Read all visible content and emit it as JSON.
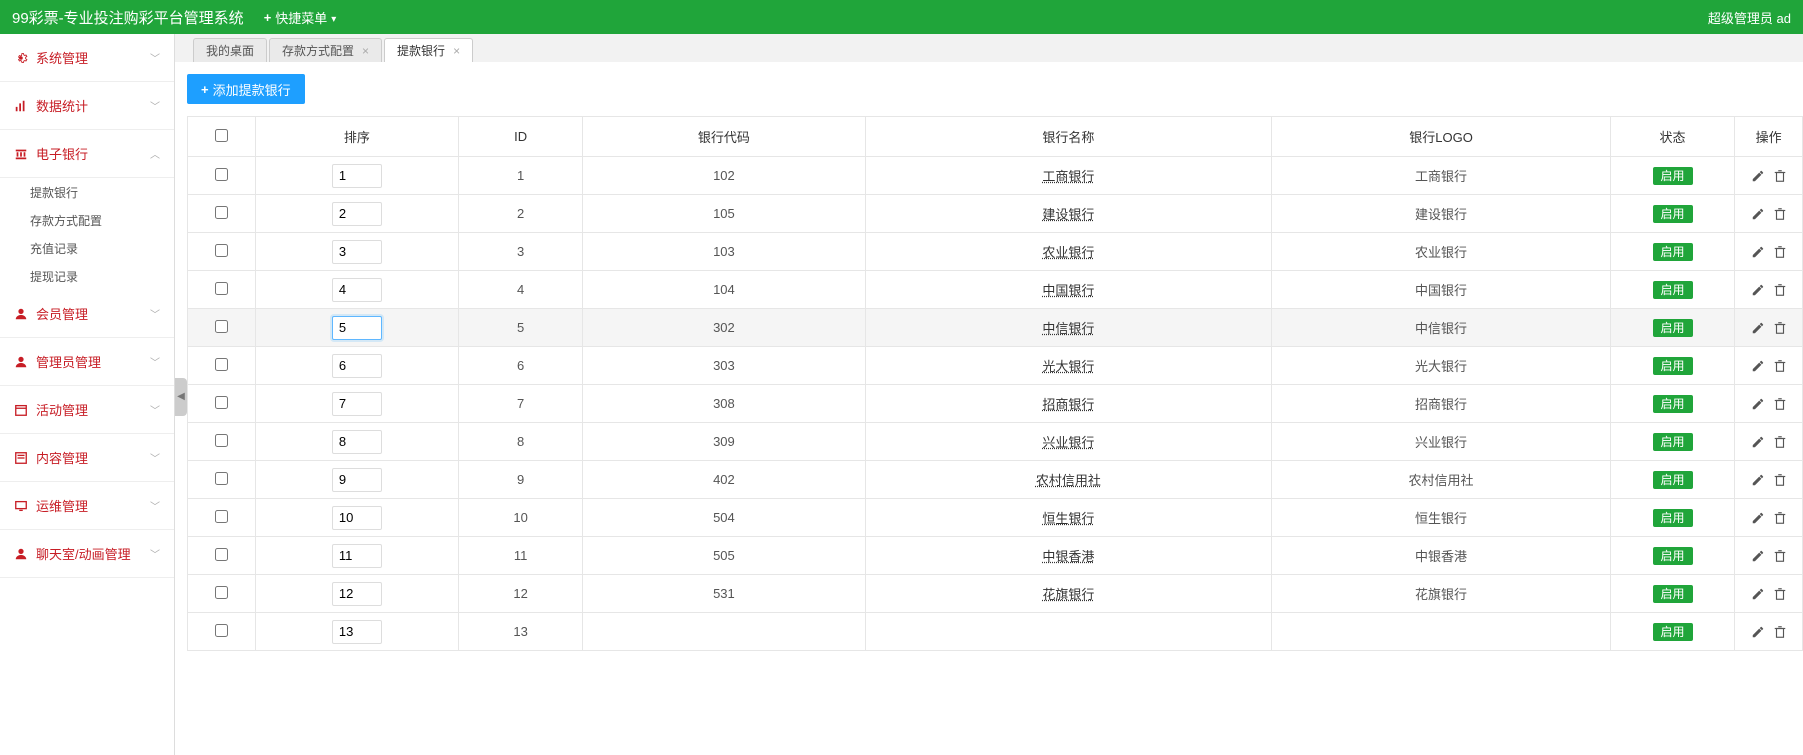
{
  "header": {
    "brand": "99彩票-专业投注购彩平台管理系统",
    "quick_menu": "快捷菜单",
    "user_label": "超级管理员  ad"
  },
  "sidebar": {
    "groups": [
      {
        "icon": "gear",
        "label": "系统管理",
        "expanded": false,
        "subs": []
      },
      {
        "icon": "chart",
        "label": "数据统计",
        "expanded": false,
        "subs": []
      },
      {
        "icon": "bank",
        "label": "电子银行",
        "expanded": true,
        "subs": [
          "提款银行",
          "存款方式配置",
          "充值记录",
          "提现记录"
        ]
      },
      {
        "icon": "user",
        "label": "会员管理",
        "expanded": false,
        "subs": []
      },
      {
        "icon": "admin",
        "label": "管理员管理",
        "expanded": false,
        "subs": []
      },
      {
        "icon": "calendar",
        "label": "活动管理",
        "expanded": false,
        "subs": []
      },
      {
        "icon": "content",
        "label": "内容管理",
        "expanded": false,
        "subs": []
      },
      {
        "icon": "ops",
        "label": "运维管理",
        "expanded": false,
        "subs": []
      },
      {
        "icon": "chat",
        "label": "聊天室/动画管理",
        "expanded": false,
        "subs": []
      }
    ]
  },
  "tabs": [
    {
      "label": "我的桌面",
      "closable": false,
      "active": false
    },
    {
      "label": "存款方式配置",
      "closable": true,
      "active": false
    },
    {
      "label": "提款银行",
      "closable": true,
      "active": true
    }
  ],
  "toolbar": {
    "add_label": "添加提款银行"
  },
  "table": {
    "headers": [
      "",
      "排序",
      "ID",
      "银行代码",
      "银行名称",
      "银行LOGO",
      "状态",
      "操作"
    ],
    "status_enabled": "启用",
    "rows": [
      {
        "sort": "1",
        "id": "1",
        "code": "102",
        "name": "工商银行",
        "logo": "工商银行",
        "focused": false
      },
      {
        "sort": "2",
        "id": "2",
        "code": "105",
        "name": "建设银行",
        "logo": "建设银行",
        "focused": false
      },
      {
        "sort": "3",
        "id": "3",
        "code": "103",
        "name": "农业银行",
        "logo": "农业银行",
        "focused": false
      },
      {
        "sort": "4",
        "id": "4",
        "code": "104",
        "name": "中国银行",
        "logo": "中国银行",
        "focused": false
      },
      {
        "sort": "5",
        "id": "5",
        "code": "302",
        "name": "中信银行",
        "logo": "中信银行",
        "focused": true
      },
      {
        "sort": "6",
        "id": "6",
        "code": "303",
        "name": "光大银行",
        "logo": "光大银行",
        "focused": false
      },
      {
        "sort": "7",
        "id": "7",
        "code": "308",
        "name": "招商银行",
        "logo": "招商银行",
        "focused": false
      },
      {
        "sort": "8",
        "id": "8",
        "code": "309",
        "name": "兴业银行",
        "logo": "兴业银行",
        "focused": false
      },
      {
        "sort": "9",
        "id": "9",
        "code": "402",
        "name": "农村信用社",
        "logo": "农村信用社",
        "focused": false
      },
      {
        "sort": "10",
        "id": "10",
        "code": "504",
        "name": "恒生银行",
        "logo": "恒生银行",
        "focused": false
      },
      {
        "sort": "11",
        "id": "11",
        "code": "505",
        "name": "中银香港",
        "logo": "中银香港",
        "focused": false
      },
      {
        "sort": "12",
        "id": "12",
        "code": "531",
        "name": "花旗银行",
        "logo": "花旗银行",
        "focused": false
      },
      {
        "sort": "13",
        "id": "13",
        "code": "",
        "name": "",
        "logo": "",
        "focused": false
      }
    ]
  }
}
